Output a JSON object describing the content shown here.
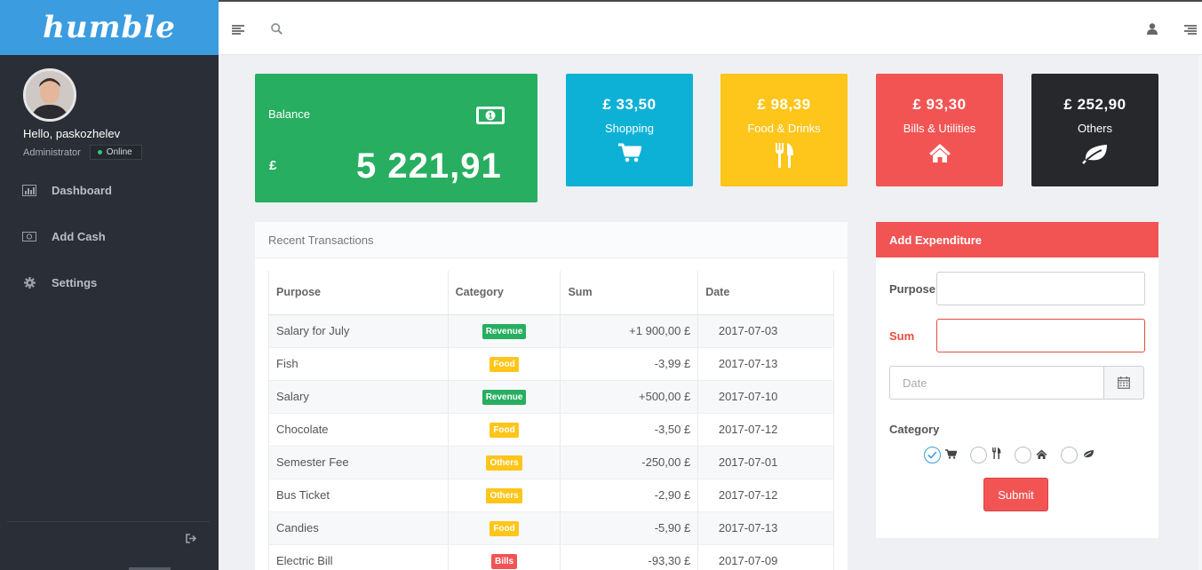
{
  "brand": "humble",
  "user": {
    "greeting": "Hello, paskozhelev",
    "role": "Administrator",
    "status": "Online"
  },
  "sidebar": {
    "items": [
      {
        "label": "Dashboard",
        "icon": "bar-chart-icon"
      },
      {
        "label": "Add Cash",
        "icon": "money-icon"
      },
      {
        "label": "Settings",
        "icon": "gear-icon"
      }
    ]
  },
  "topbar": {
    "icons": [
      "menu-icon",
      "search-icon",
      "user-icon",
      "right-menu-icon"
    ]
  },
  "balance": {
    "label": "Balance",
    "currency": "£",
    "amount": "5 221,91",
    "color": "#27ae60"
  },
  "stats": [
    {
      "value": "£ 33,50",
      "label": "Shopping",
      "icon": "cart-icon",
      "color": "#0eb1d6"
    },
    {
      "value": "£ 98,39",
      "label": "Food & Drinks",
      "icon": "cutlery-icon",
      "color": "#fec51a"
    },
    {
      "value": "£ 93,30",
      "label": "Bills & Utilities",
      "icon": "home-icon",
      "color": "#f25454"
    },
    {
      "value": "£ 252,90",
      "label": "Others",
      "icon": "leaf-icon",
      "color": "#26282c"
    }
  ],
  "transactions": {
    "title": "Recent Transactions",
    "columns": [
      "Purpose",
      "Category",
      "Sum",
      "Date"
    ],
    "rows": [
      {
        "purpose": "Salary for July",
        "category": "Revenue",
        "sum": "+1 900,00 £",
        "date": "2017-07-03"
      },
      {
        "purpose": "Fish",
        "category": "Food",
        "sum": "-3,99 £",
        "date": "2017-07-13"
      },
      {
        "purpose": "Salary",
        "category": "Revenue",
        "sum": "+500,00 £",
        "date": "2017-07-10"
      },
      {
        "purpose": "Chocolate",
        "category": "Food",
        "sum": "-3,50 £",
        "date": "2017-07-12"
      },
      {
        "purpose": "Semester Fee",
        "category": "Others",
        "sum": "-250,00 £",
        "date": "2017-07-01"
      },
      {
        "purpose": "Bus Ticket",
        "category": "Others",
        "sum": "-2,90 £",
        "date": "2017-07-12"
      },
      {
        "purpose": "Candies",
        "category": "Food",
        "sum": "-5,90 £",
        "date": "2017-07-13"
      },
      {
        "purpose": "Electric Bill",
        "category": "Bills",
        "sum": "-93,30 £",
        "date": "2017-07-09"
      }
    ],
    "badge_colors": {
      "Revenue": "#27ae60",
      "Food": "#fec51a",
      "Others": "#fec51a",
      "Bills": "#f25454"
    }
  },
  "form": {
    "title": "Add Expenditure",
    "purpose_label": "Purpose",
    "purpose_value": "",
    "sum_label": "Sum",
    "sum_value": "",
    "date_placeholder": "Date",
    "category_label": "Category",
    "category_options": [
      "cart-icon",
      "cutlery-icon",
      "home-icon",
      "leaf-icon"
    ],
    "selected_category": "cart-icon",
    "submit_label": "Submit"
  }
}
